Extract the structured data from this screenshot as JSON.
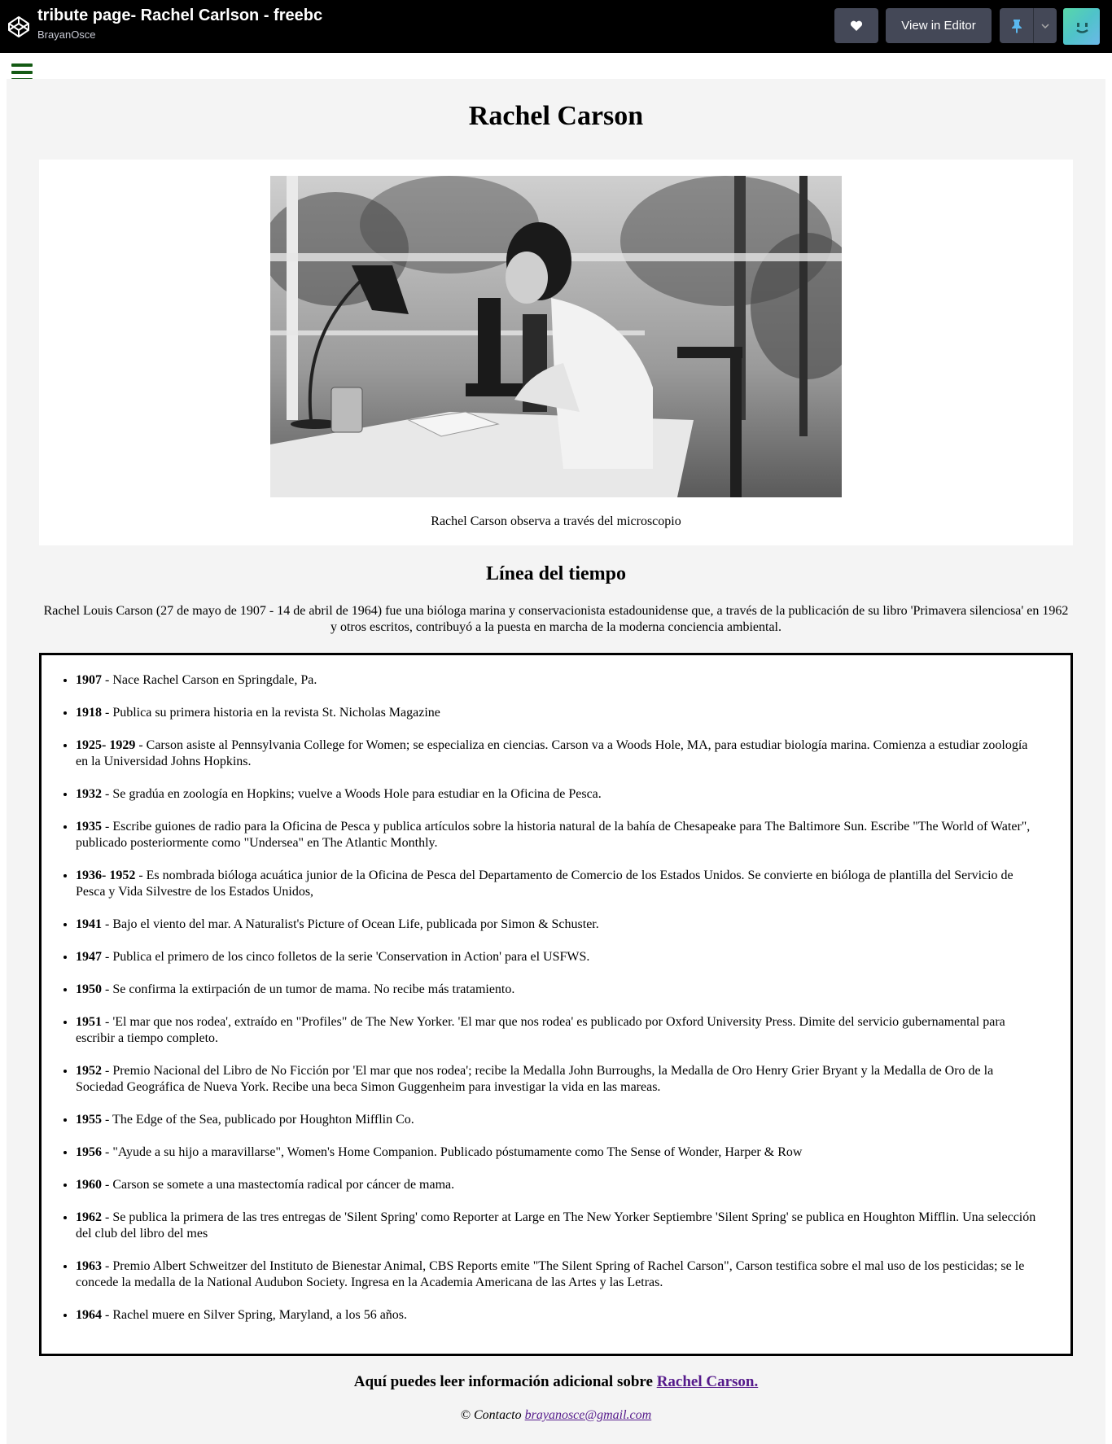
{
  "codepen_bar": {
    "pen_title": "tribute page- Rachel Carlson - freebc",
    "author": "BrayanOsce",
    "view_in_editor_label": "View in Editor",
    "icons": [
      "codepen-logo-icon",
      "heart-icon",
      "pin-icon",
      "chevron-down-icon",
      "avatar"
    ],
    "colors": {
      "bar": "#000000",
      "button": "#444857",
      "pin": "#47cf73"
    }
  },
  "page": {
    "title": "Rachel Carson",
    "image_caption": "Rachel Carson observa a través del microscopio",
    "timeline_heading": "Línea del tiempo",
    "intro": "Rachel Louis Carson (27 de mayo de 1907 - 14 de abril de 1964) fue una bióloga marina y conservacionista estadounidense que, a través de la publicación de su libro 'Primavera silenciosa' en 1962 y otros escritos, contribuyó a la puesta en marcha de la moderna conciencia ambiental.",
    "timeline": [
      {
        "year": "1907",
        "text": " - Nace Rachel Carson en Springdale, Pa."
      },
      {
        "year": "1918",
        "text": " - Publica su primera historia en la revista St. Nicholas Magazine"
      },
      {
        "year": "1925- 1929",
        "text": " - Carson asiste al Pennsylvania College for Women; se especializa en ciencias. Carson va a Woods Hole, MA, para estudiar biología marina. Comienza a estudiar zoología en la Universidad Johns Hopkins."
      },
      {
        "year": "1932",
        "text": " - Se gradúa en zoología en Hopkins; vuelve a Woods Hole para estudiar en la Oficina de Pesca."
      },
      {
        "year": "1935",
        "text": " - Escribe guiones de radio para la Oficina de Pesca y publica artículos sobre la historia natural de la bahía de Chesapeake para The Baltimore Sun. Escribe \"The World of Water\", publicado posteriormente como \"Undersea\" en The Atlantic Monthly."
      },
      {
        "year": "1936- 1952",
        "text": " - Es nombrada bióloga acuática junior de la Oficina de Pesca del Departamento de Comercio de los Estados Unidos. Se convierte en bióloga de plantilla del Servicio de Pesca y Vida Silvestre de los Estados Unidos,"
      },
      {
        "year": "1941",
        "text": " - Bajo el viento del mar. A Naturalist's Picture of Ocean Life, publicada por Simon & Schuster."
      },
      {
        "year": "1947",
        "text": " - Publica el primero de los cinco folletos de la serie 'Conservation in Action' para el USFWS."
      },
      {
        "year": "1950",
        "text": " - Se confirma la extirpación de un tumor de mama. No recibe más tratamiento."
      },
      {
        "year": "1951",
        "text": " - 'El mar que nos rodea', extraído en \"Profiles\" de The New Yorker. 'El mar que nos rodea' es publicado por Oxford University Press. Dimite del servicio gubernamental para escribir a tiempo completo."
      },
      {
        "year": "1952",
        "text": " - Premio Nacional del Libro de No Ficción por 'El mar que nos rodea'; recibe la Medalla John Burroughs, la Medalla de Oro Henry Grier Bryant y la Medalla de Oro de la Sociedad Geográfica de Nueva York. Recibe una beca Simon Guggenheim para investigar la vida en las mareas."
      },
      {
        "year": "1955",
        "text": " - The Edge of the Sea, publicado por Houghton Mifflin Co."
      },
      {
        "year": "1956",
        "text": " - \"Ayude a su hijo a maravillarse\", Women's Home Companion. Publicado póstumamente como The Sense of Wonder, Harper & Row"
      },
      {
        "year": "1960",
        "text": " - Carson se somete a una mastectomía radical por cáncer de mama."
      },
      {
        "year": "1962",
        "text": " - Se publica la primera de las tres entregas de 'Silent Spring' como Reporter at Large en The New Yorker Septiembre 'Silent Spring' se publica en Houghton Mifflin. Una selección del club del libro del mes"
      },
      {
        "year": "1963",
        "text": " - Premio Albert Schweitzer del Instituto de Bienestar Animal, CBS Reports emite \"The Silent Spring of Rachel Carson\", Carson testifica sobre el mal uso de los pesticidas; se le concede la medalla de la National Audubon Society. Ingresa en la Academia Americana de las Artes y las Letras."
      },
      {
        "year": "1964",
        "text": " - Rachel muere en Silver Spring, Maryland, a los 56 años."
      }
    ],
    "footer_text": "Aquí puedes leer información adicional sobre ",
    "footer_link": "Rachel Carson.",
    "contact_text": "© Contacto ",
    "contact_email": "brayanosce@gmail.com"
  }
}
